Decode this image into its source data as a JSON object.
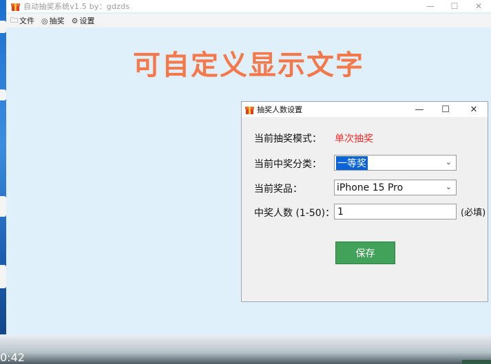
{
  "main_window": {
    "title": "自动抽奖系统v1.5  by：gdzds",
    "controls": {
      "minimize": "—",
      "maximize": "☐",
      "close": "✕"
    },
    "menu": [
      {
        "label": "文件",
        "icon": "folder-icon"
      },
      {
        "label": "抽奖",
        "icon": "target-icon"
      },
      {
        "label": "设置",
        "icon": "gear-icon"
      }
    ],
    "display_text": "可自定义显示文字"
  },
  "dialog": {
    "title": "抽奖人数设置",
    "controls": {
      "minimize": "—",
      "maximize": "☐",
      "close": "✕"
    },
    "mode_label": "当前抽奖模式：",
    "mode_value": "单次抽奖",
    "category_label": "当前中奖分类：",
    "category_value": "一等奖",
    "prize_label": "当前奖品：",
    "prize_value": "iPhone 15 Pro",
    "count_label": "中奖人数 (1-50)：",
    "count_value": "1",
    "required_note": "(必填)",
    "save_label": "保存"
  },
  "taskbar": {
    "clock": "0:42"
  },
  "colors": {
    "display_text": "#f4784a",
    "mode_value": "#ff2a2a",
    "save_button": "#43a25a",
    "background": "#dff0fb"
  }
}
